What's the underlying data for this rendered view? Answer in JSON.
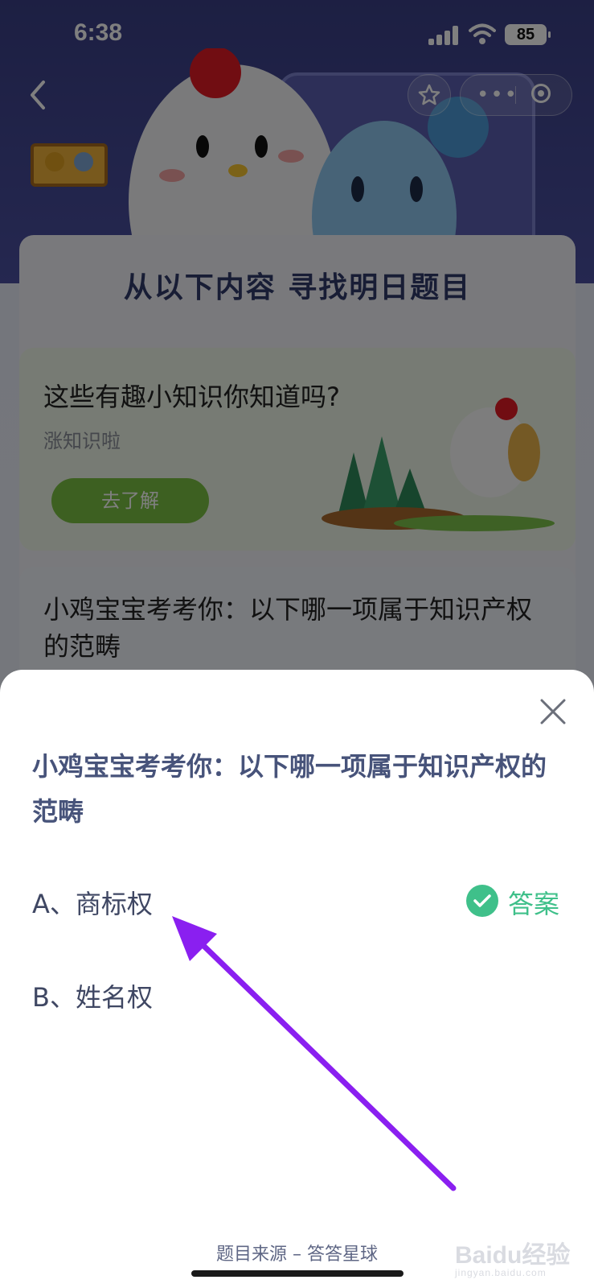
{
  "status_bar": {
    "time": "6:38",
    "battery": "85"
  },
  "nav": {
    "back_icon": "chevron-left-icon",
    "star_icon": "star-icon",
    "more_icon": "more-dots-icon",
    "target_icon": "target-icon"
  },
  "background": {
    "panel_title": "从以下内容 寻找明日题目",
    "card1": {
      "title": "这些有趣小知识你知道吗?",
      "subtitle": "涨知识啦",
      "button": "去了解"
    },
    "card2": {
      "title": "小鸡宝宝考考你：以下哪一项属于知识产权的范畴"
    }
  },
  "sheet": {
    "question": "小鸡宝宝考考你：以下哪一项属于知识产权的范畴",
    "options": [
      {
        "label": "A、商标权",
        "is_answer": true
      },
      {
        "label": "B、姓名权",
        "is_answer": false
      }
    ],
    "answer_tag": "答案",
    "source": "题目来源 – 答答星球"
  },
  "watermark": {
    "brand": "Baidu经验",
    "url": "jingyan.baidu.com"
  },
  "colors": {
    "accent_green": "#3fc08a",
    "arrow_purple": "#8a1ff0",
    "question_text": "#47537a",
    "button_green": "#7bc142"
  }
}
